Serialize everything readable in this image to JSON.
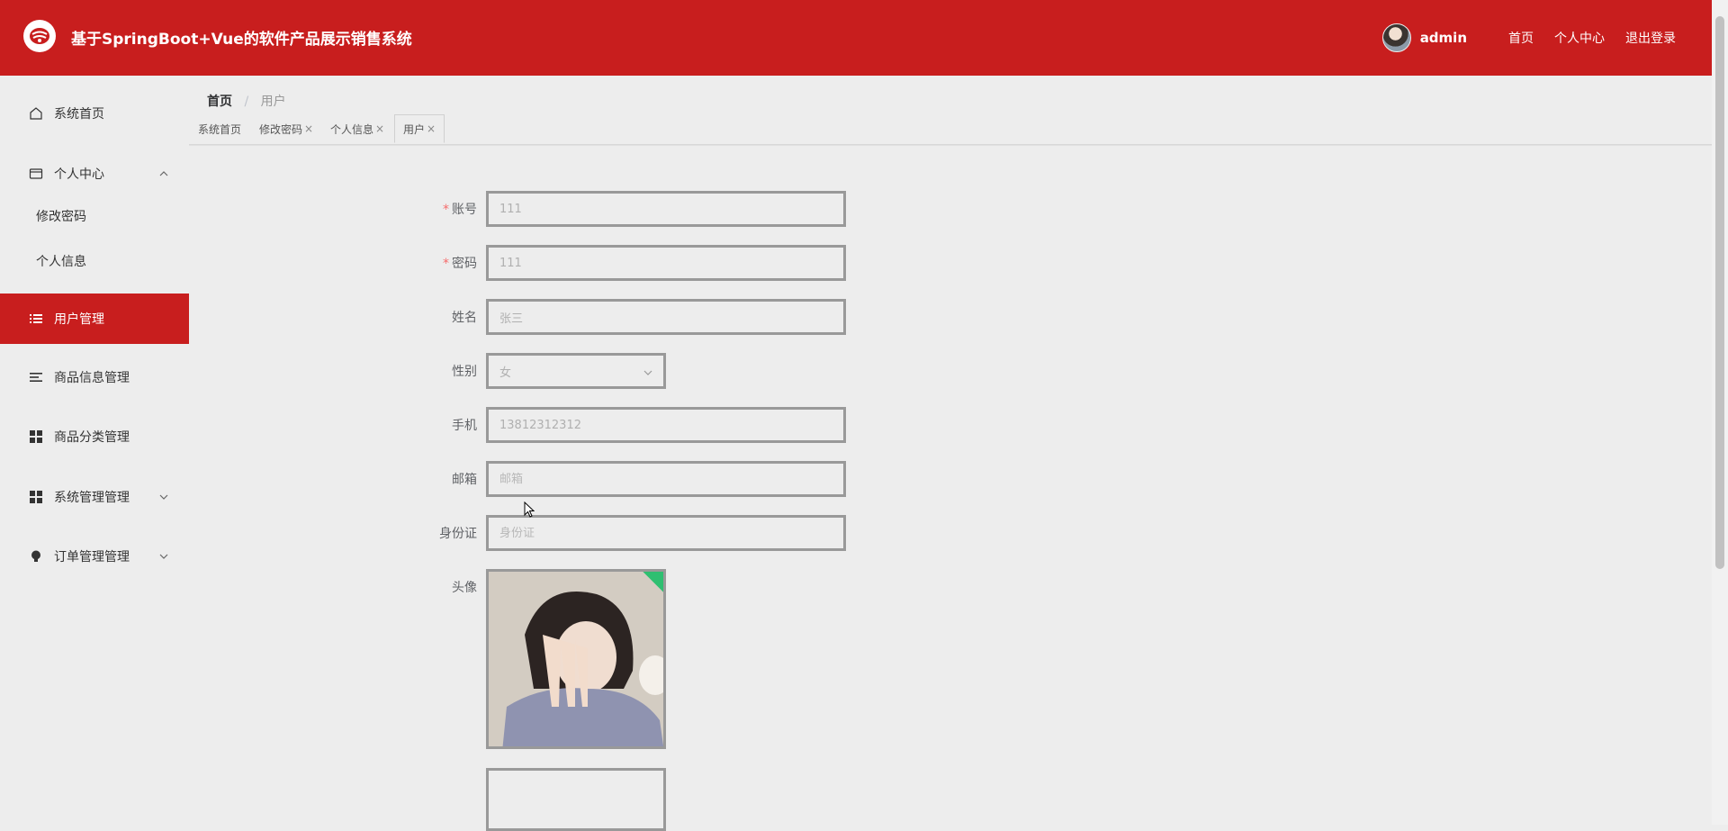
{
  "app": {
    "title": "基于SpringBoot+Vue的软件产品展示销售系统"
  },
  "header": {
    "username": "admin",
    "links": [
      "首页",
      "个人中心",
      "退出登录"
    ]
  },
  "sidebar": {
    "items": [
      {
        "label": "系统首页",
        "icon": "home-icon"
      },
      {
        "label": "个人中心",
        "icon": "card-icon",
        "expanded": true
      },
      {
        "label": "修改密码",
        "sub": true
      },
      {
        "label": "个人信息",
        "sub": true
      },
      {
        "label": "用户管理",
        "icon": "list-icon",
        "active": true
      },
      {
        "label": "商品信息管理",
        "icon": "menu-icon"
      },
      {
        "label": "商品分类管理",
        "icon": "grid-icon"
      },
      {
        "label": "系统管理管理",
        "icon": "grid-icon",
        "expandable": true
      },
      {
        "label": "订单管理管理",
        "icon": "bulb-icon",
        "expandable": true
      }
    ]
  },
  "breadcrumb": {
    "home": "首页",
    "current": "用户"
  },
  "tabs": [
    {
      "label": "系统首页",
      "closable": false
    },
    {
      "label": "修改密码",
      "closable": true
    },
    {
      "label": "个人信息",
      "closable": true
    },
    {
      "label": "用户",
      "closable": true,
      "active": true
    }
  ],
  "form": {
    "account": {
      "label": "账号",
      "value": "111",
      "required": true
    },
    "password": {
      "label": "密码",
      "value": "111",
      "required": true
    },
    "name": {
      "label": "姓名",
      "value": "张三"
    },
    "gender": {
      "label": "性别",
      "value": "女"
    },
    "phone": {
      "label": "手机",
      "value": "13812312312"
    },
    "email": {
      "label": "邮箱",
      "placeholder": "邮箱"
    },
    "idcard": {
      "label": "身份证",
      "placeholder": "身份证"
    },
    "avatar": {
      "label": "头像"
    }
  },
  "colors": {
    "brand": "#c81e1e",
    "required": "#f56c6c"
  }
}
